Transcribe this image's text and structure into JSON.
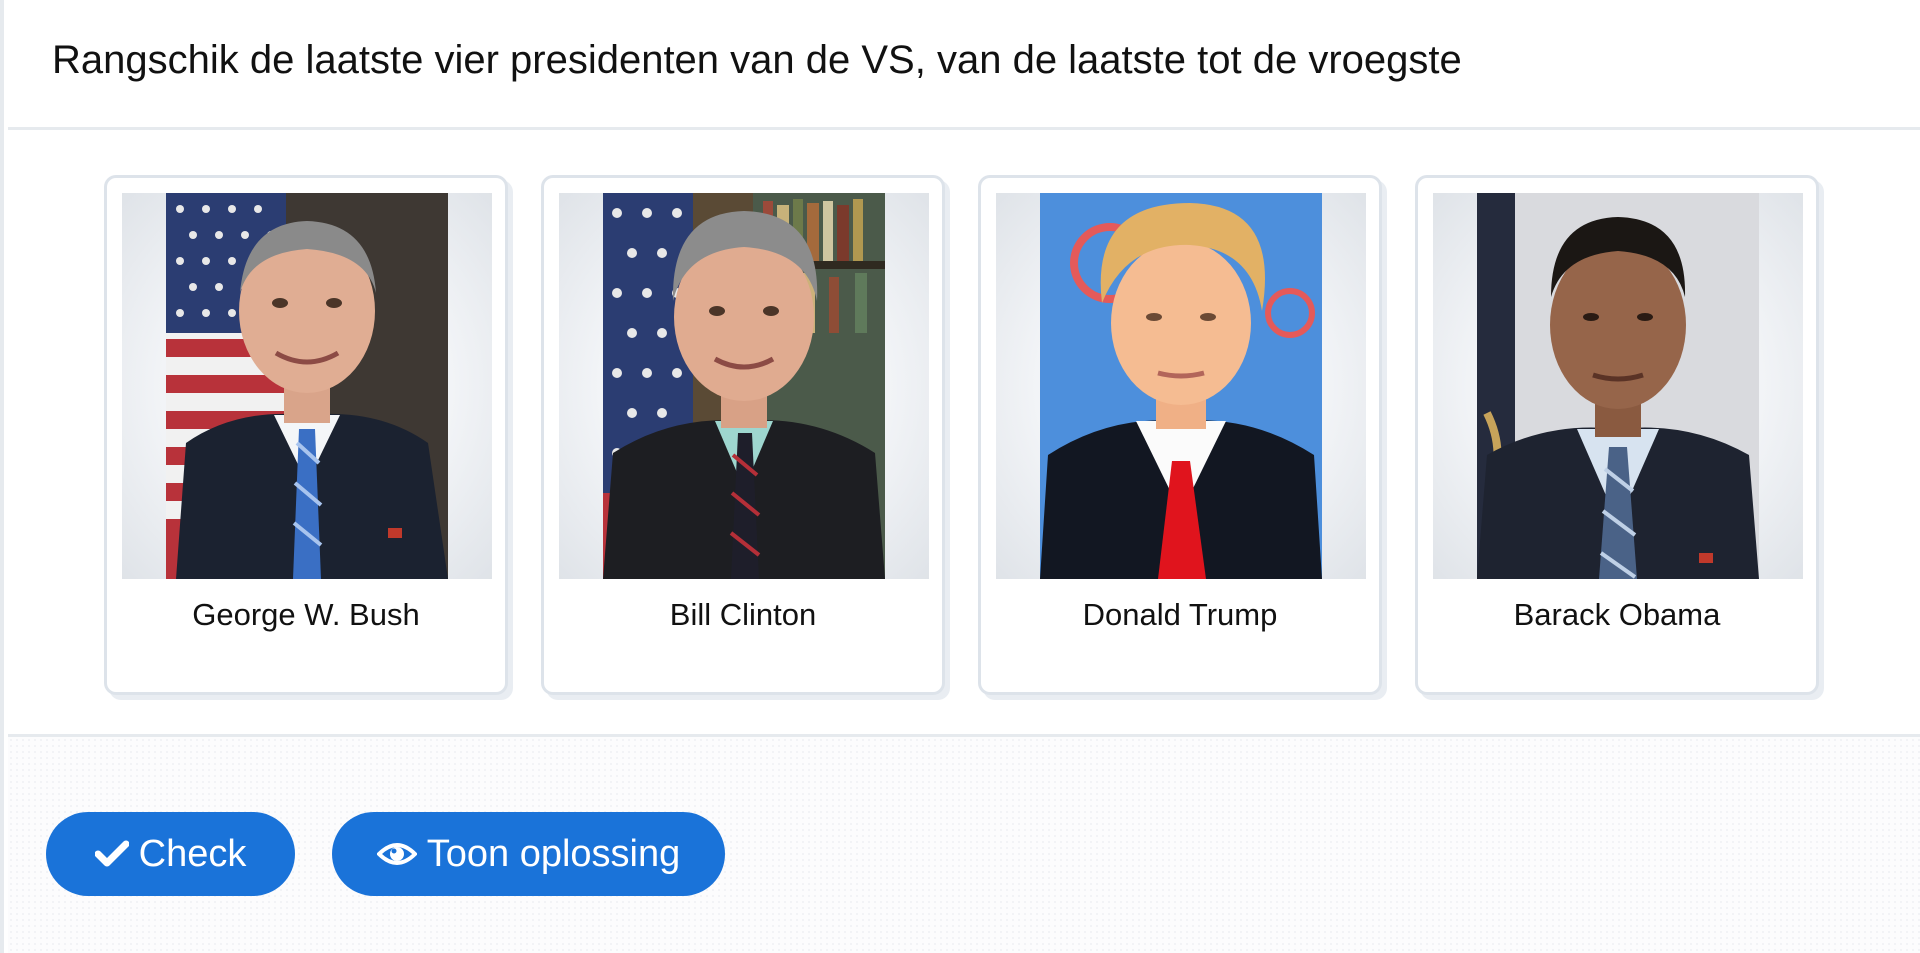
{
  "question": {
    "text": "Rangschik de laatste vier presidenten van de VS, van de laatste tot de vroegste"
  },
  "cards": [
    {
      "name": "George W. Bush"
    },
    {
      "name": "Bill Clinton"
    },
    {
      "name": "Donald Trump"
    },
    {
      "name": "Barack Obama"
    }
  ],
  "buttons": {
    "check_label": "Check",
    "check_icon": "checkmark-icon",
    "solution_label": "Toon oplossing",
    "solution_icon": "eye-icon",
    "color": "#1a73d9"
  }
}
